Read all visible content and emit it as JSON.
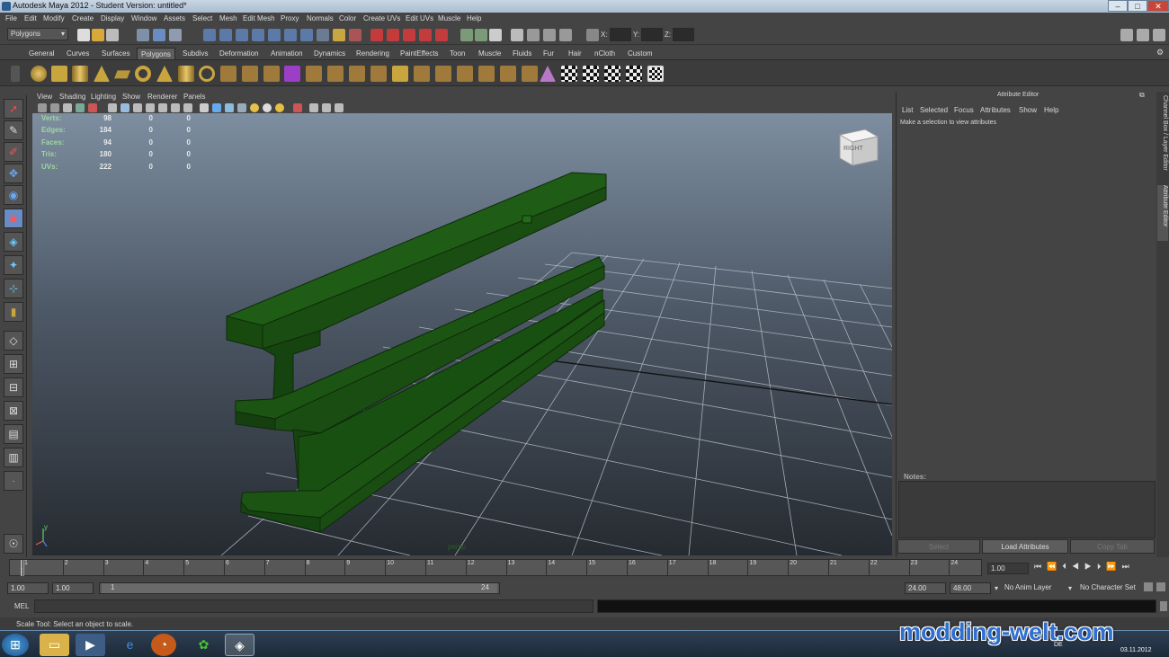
{
  "title": "Autodesk Maya 2012 - Student Version: untitled*",
  "window_buttons": [
    "–",
    "□",
    "✕"
  ],
  "menu": [
    "File",
    "Edit",
    "Modify",
    "Create",
    "Display",
    "Window",
    "Assets",
    "Select",
    "Mesh",
    "Edit Mesh",
    "Proxy",
    "Normals",
    "Color",
    "Create UVs",
    "Edit UVs",
    "Muscle",
    "Help"
  ],
  "mode_dropdown": "Polygons",
  "xyz": {
    "x": "X:",
    "y": "Y:",
    "z": "Z:"
  },
  "shelf_tabs": [
    "General",
    "Curves",
    "Surfaces",
    "Polygons",
    "Subdivs",
    "Deformation",
    "Animation",
    "Dynamics",
    "Rendering",
    "PaintEffects",
    "Toon",
    "Muscle",
    "Fluids",
    "Fur",
    "Hair",
    "nCloth",
    "Custom"
  ],
  "active_shelf": "Polygons",
  "panel_menu": [
    "View",
    "Shading",
    "Lighting",
    "Show",
    "Renderer",
    "Panels"
  ],
  "hud": {
    "rows": [
      {
        "label": "Verts:",
        "v1": "98",
        "v2": "0",
        "v3": "0"
      },
      {
        "label": "Edges:",
        "v1": "184",
        "v2": "0",
        "v3": "0"
      },
      {
        "label": "Faces:",
        "v1": "94",
        "v2": "0",
        "v3": "0"
      },
      {
        "label": "Tris:",
        "v1": "180",
        "v2": "0",
        "v3": "0"
      },
      {
        "label": "UVs:",
        "v1": "222",
        "v2": "0",
        "v3": "0"
      }
    ],
    "viewcube": "RIGHT",
    "camera": "persp",
    "axis_y": "y"
  },
  "attribute_editor": {
    "title": "Attribute Editor",
    "menu": [
      "List",
      "Selected",
      "Focus",
      "Attributes",
      "Show",
      "Help"
    ],
    "message": "Make a selection to view attributes",
    "notes_label": "Notes:",
    "buttons": [
      "Select",
      "Load Attributes",
      "Copy Tab"
    ]
  },
  "side_tabs": [
    "Channel Box / Layer Editor",
    "Attribute Editor"
  ],
  "timeline": {
    "ticks": [
      "1",
      "2",
      "3",
      "4",
      "5",
      "6",
      "7",
      "8",
      "9",
      "10",
      "11",
      "12",
      "13",
      "14",
      "15",
      "16",
      "17",
      "18",
      "19",
      "20",
      "21",
      "22",
      "23",
      "24"
    ],
    "current": "1.00",
    "current_frame_marker": "1"
  },
  "range": {
    "start": "1.00",
    "start2": "1.00",
    "slider_start": "1",
    "slider_end": "24",
    "end": "24.00",
    "end2": "48.00",
    "anim_layer": "No Anim Layer",
    "char_set": "No Character Set"
  },
  "mel_label": "MEL",
  "help_line": "Scale Tool: Select an object to scale.",
  "taskbar": {
    "date": "03.11.2012",
    "lang": "DE"
  },
  "watermark": "modding-welt.com",
  "colors": {
    "beam": "#1a4d12",
    "beam_top": "#1f5c16",
    "beam_dark": "#123a0c",
    "hud_label": "#9fd69f"
  }
}
